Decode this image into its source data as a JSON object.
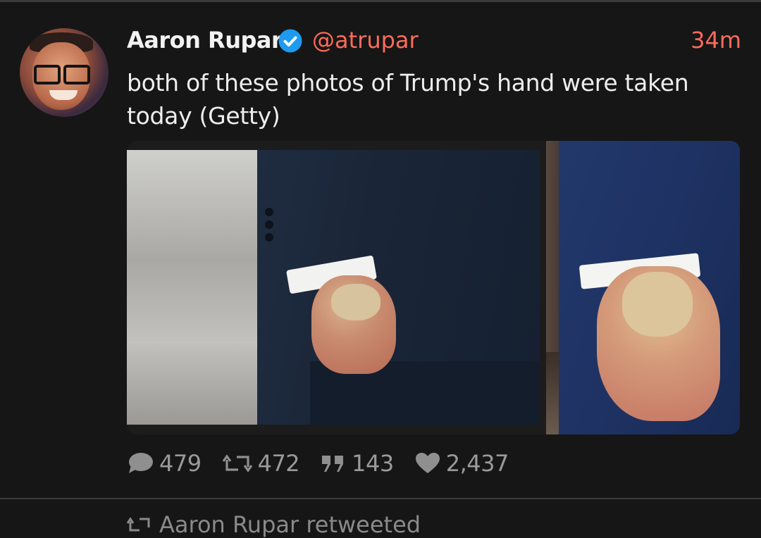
{
  "tweet": {
    "author_name": "Aaron Rupar",
    "handle": "@atrupar",
    "time": "34m",
    "text": "both of these photos of Trump's hand were taken today (Getty)",
    "verified": true,
    "accent_color": "#ff6b5a",
    "verified_color": "#1d9bf0"
  },
  "actions": {
    "replies": "479",
    "retweets": "472",
    "quotes": "143",
    "likes": "2,437"
  },
  "next": {
    "retweeted_label": "Aaron Rupar retweeted"
  },
  "icons": {
    "verified": "verified-badge-icon",
    "reply": "reply-bubble-icon",
    "retweet": "retweet-icon",
    "quote": "quote-icon",
    "like": "heart-icon"
  }
}
